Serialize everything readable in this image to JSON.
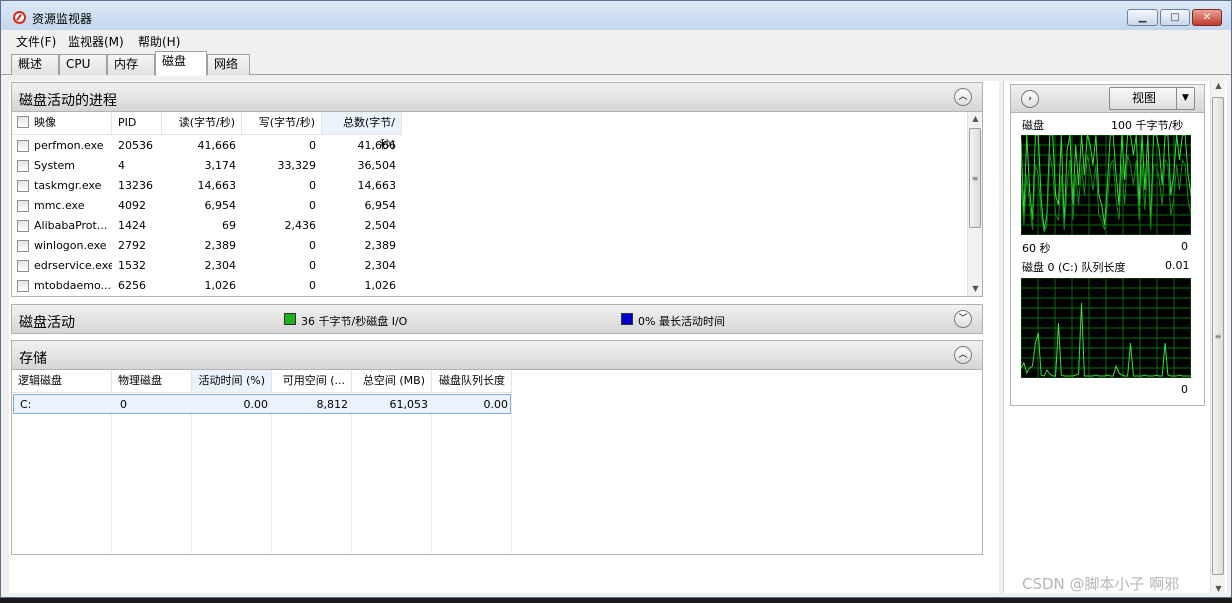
{
  "window": {
    "title": "资源监视器"
  },
  "menu": [
    "文件(F)",
    "监视器(M)",
    "帮助(H)"
  ],
  "tabs": [
    "概述",
    "CPU",
    "内存",
    "磁盘",
    "网络"
  ],
  "active_tab": "磁盘",
  "disk_processes": {
    "title": "磁盘活动的进程",
    "columns": [
      "映像",
      "PID",
      "读(字节/秒)",
      "写(字节/秒)",
      "总数(字节/秒)"
    ],
    "rows": [
      {
        "image": "perfmon.exe",
        "pid": "20536",
        "read": "41,666",
        "write": "0",
        "total": "41,666"
      },
      {
        "image": "System",
        "pid": "4",
        "read": "3,174",
        "write": "33,329",
        "total": "36,504"
      },
      {
        "image": "taskmgr.exe",
        "pid": "13236",
        "read": "14,663",
        "write": "0",
        "total": "14,663"
      },
      {
        "image": "mmc.exe",
        "pid": "4092",
        "read": "6,954",
        "write": "0",
        "total": "6,954"
      },
      {
        "image": "AlibabaProt...",
        "pid": "1424",
        "read": "69",
        "write": "2,436",
        "total": "2,504"
      },
      {
        "image": "winlogon.exe",
        "pid": "2792",
        "read": "2,389",
        "write": "0",
        "total": "2,389"
      },
      {
        "image": "edrservice.exe",
        "pid": "1532",
        "read": "2,304",
        "write": "0",
        "total": "2,304"
      },
      {
        "image": "mtobdaemo...",
        "pid": "6256",
        "read": "1,026",
        "write": "0",
        "total": "1,026"
      }
    ]
  },
  "disk_activity": {
    "title": "磁盘活动",
    "io_label": "36 千字节/秒磁盘 I/O",
    "active_time_label": "0% 最长活动时间",
    "io_color": "#1db31d",
    "active_time_color": "#0000cc"
  },
  "storage": {
    "title": "存储",
    "columns": [
      "逻辑磁盘",
      "物理磁盘",
      "活动时间 (%)",
      "可用空间 (...",
      "总空间 (MB)",
      "磁盘队列长度"
    ],
    "rows": [
      {
        "logical": "C:",
        "physical": "0",
        "active_time": "0.00",
        "free_space": "8,812",
        "total_space": "61,053",
        "queue_length": "0.00"
      }
    ]
  },
  "side_panel": {
    "view_button": "视图",
    "chart1": {
      "label": "磁盘",
      "max_label": "100 千字节/秒",
      "time_label": "60 秒",
      "min_label": "0"
    },
    "chart2": {
      "label": "磁盘 0 (C:) 队列长度",
      "max_label": "0.01",
      "min_label": "0"
    }
  },
  "chart_data": [
    {
      "type": "line",
      "title": "磁盘",
      "ylabel": "100 千字节/秒",
      "xlabel": "60 秒",
      "ylim": [
        0,
        100
      ],
      "series": [
        {
          "values": [
            95,
            20,
            100,
            45,
            15,
            100,
            100,
            35,
            5,
            20,
            100,
            100,
            40,
            30,
            100,
            10,
            85,
            100,
            30,
            90,
            50,
            100,
            60,
            100,
            90,
            70,
            100,
            40,
            30,
            10,
            50,
            100,
            100,
            60,
            30,
            100,
            55,
            100,
            100,
            80,
            100,
            30,
            100,
            45,
            100,
            10,
            100,
            100,
            85,
            50,
            100,
            100,
            40,
            60,
            100,
            75,
            100,
            100,
            60,
            40
          ]
        },
        {
          "values": [
            55,
            10,
            60,
            30,
            5,
            70,
            60,
            20,
            3,
            10,
            80,
            65,
            20,
            15,
            60,
            5,
            50,
            75,
            15,
            60,
            30,
            70,
            40,
            80,
            65,
            45,
            70,
            20,
            15,
            5,
            30,
            70,
            75,
            35,
            15,
            70,
            30,
            80,
            70,
            50,
            75,
            15,
            70,
            25,
            75,
            5,
            70,
            70,
            55,
            30,
            75,
            70,
            20,
            35,
            70,
            45,
            75,
            70,
            35,
            20
          ]
        }
      ],
      "grid": true,
      "colors": [
        "#38e038",
        "#158a15"
      ]
    },
    {
      "type": "line",
      "title": "磁盘 0 (C:) 队列长度",
      "ylim": [
        0,
        0.01
      ],
      "series": [
        {
          "values": [
            0.001,
            0.0015,
            0.0005,
            0.001,
            0.0012,
            0.0035,
            0.0045,
            0.0003,
            0.0002,
            0.0008,
            0.0004,
            0.0002,
            0.0002,
            0.0055,
            0.0003,
            0.0002,
            0.0002,
            0.0002,
            0.0002,
            0.0003,
            0.0004,
            0.0075,
            0.0002,
            0.0002,
            0.0002,
            0.0002,
            0.0003,
            0.0002,
            0.0002,
            0.0002,
            0.0003,
            0.0002,
            0.0002,
            0.0012,
            0.0005,
            0.0003,
            0.0002,
            0.0002,
            0.0035,
            0.0002,
            0.0002,
            0.0002,
            0.0002,
            0.0003,
            0.0002,
            0.0002,
            0.0002,
            0.0003,
            0.0002,
            0.0002,
            0.0035,
            0.0003,
            0.0002,
            0.0002,
            0.0002,
            0.0003,
            0.0002,
            0.0002,
            0.0002,
            0.0002
          ]
        }
      ],
      "grid": true,
      "colors": [
        "#38e038"
      ]
    }
  ],
  "watermark": "CSDN @脚本小子 啊邪"
}
